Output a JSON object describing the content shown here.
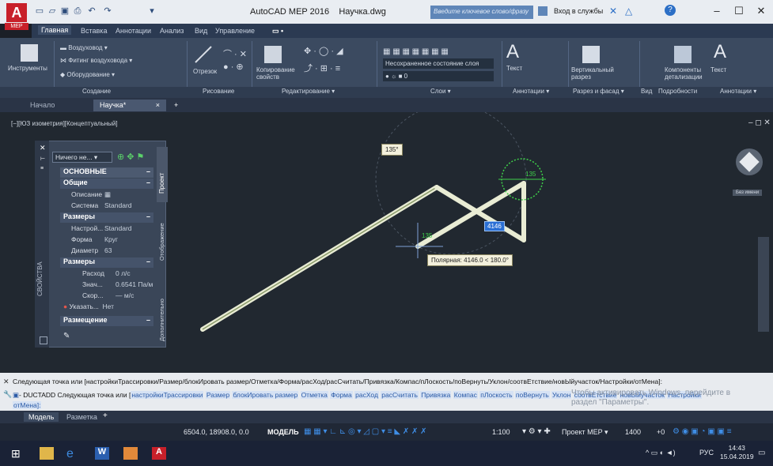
{
  "title_bar": {
    "app_title": "AutoCAD MEP 2016",
    "file_name": "Научка.dwg",
    "search_placeholder": "Введите ключевое слово/фразу",
    "sign_in": "Вход в службы",
    "app_badge": "MEP"
  },
  "ribbon_tabs": [
    "Главная",
    "Вставка",
    "Аннотации",
    "Анализ",
    "Вид",
    "Управление"
  ],
  "ribbon": {
    "tools_label": "Инструменты",
    "build_items": [
      "Воздуховод",
      "Фитинг воздуховода",
      "Оборудование"
    ],
    "line_label": "Отрезок",
    "copy_props": "Копирование свойств",
    "layer_state": "Несохраненное состояние слоя",
    "layer_current": "0",
    "text_label": "Текст",
    "vertical_section": "Вертикальный разрез",
    "components": "Компоненты детализации",
    "text_label2": "Текст",
    "panel_titles": [
      "Создание",
      "Рисование",
      "Редактирование ▾",
      "Слои ▾",
      "Аннотации ▾",
      "Разрез и фасад ▾",
      "Вид",
      "Подробности",
      "Аннотации ▾"
    ]
  },
  "doc_tabs": [
    {
      "label": "Начало"
    },
    {
      "label": "Научка*"
    }
  ],
  "viewport_label": "[−][ЮЗ изометрия][Концептуальный]",
  "palette": {
    "dropdown": "Ничего не...",
    "side_title": "Проект",
    "side_tabs": [
      "Отображение",
      "Дополнительно"
    ],
    "strip_label": "СВОЙСТВА",
    "sections": [
      {
        "header": "ОСНОВНЫЕ"
      },
      {
        "header": "Общие"
      }
    ],
    "rows_general": [
      {
        "key": "Описание",
        "val": ""
      },
      {
        "key": "Система",
        "val": "Standard"
      }
    ],
    "header_sizes": "Размеры",
    "rows_sizes": [
      {
        "key": "Настрой...",
        "val": "Standard"
      },
      {
        "key": "Форма",
        "val": "Круг"
      },
      {
        "key": "Диаметр",
        "val": "63"
      }
    ],
    "header_sizes2": "Размеры",
    "rows_sizes2": [
      {
        "key": "Расход",
        "val": "0 л/с"
      },
      {
        "key": "Знач...",
        "val": "0.6541 Па/м"
      },
      {
        "key": "Скор...",
        "val": "— м/с"
      }
    ],
    "indicate": {
      "key": "Указать...",
      "val": "Нет"
    },
    "header_placement": "Размещение"
  },
  "canvas": {
    "angle_tooltip": "135°",
    "dimension_input": "4146",
    "polar_tooltip": "Полярная: 4146.0 < 180.0°",
    "marker_labels": [
      "135",
      "135"
    ],
    "viewcube_label": "Без имени"
  },
  "command_line": {
    "line1": "Следующая точка или [настройкиТрассировки/Размер/блокИровать размер/Отметка/Форма/расХод/расСчитать/Привязка/Компас/пЛоскость/поВернуть/Уклон/соотвЕтствие/новЫйучасток/Настройки/отМена]:",
    "line2_prefix": "- DUCTADD Следующая точка или [",
    "keywords": [
      "настройкиТрассировки",
      "Размер",
      "блокИровать размер",
      "Отметка",
      "Форма",
      "расХод",
      "расСчитать",
      "Привязка",
      "Компас",
      "пЛоскость",
      "поВернуть",
      "Уклон",
      "соотвЕтствие",
      "новЫйучасток",
      "Настройки"
    ],
    "line3": "отМена]:"
  },
  "watermark": {
    "line1": "Чтобы активировать Windows, перейдите в",
    "line2": "раздел \"Параметры\"."
  },
  "layout_tabs": [
    "Модель",
    "Разметка"
  ],
  "status_bar": {
    "coordinates": "6504.0, 18908.0, 0.0",
    "model": "МОДЕЛЬ",
    "scale": "1:100",
    "project": "Проект MEP",
    "value": "1400",
    "offset": "+0"
  },
  "taskbar": {
    "lang": "РУС",
    "time": "14:43",
    "date": "15.04.2019"
  },
  "colors": {
    "accent": "#c8202a",
    "duct": "#e9ecd4",
    "marker": "#3fcf4a",
    "canvas": "#212830"
  }
}
